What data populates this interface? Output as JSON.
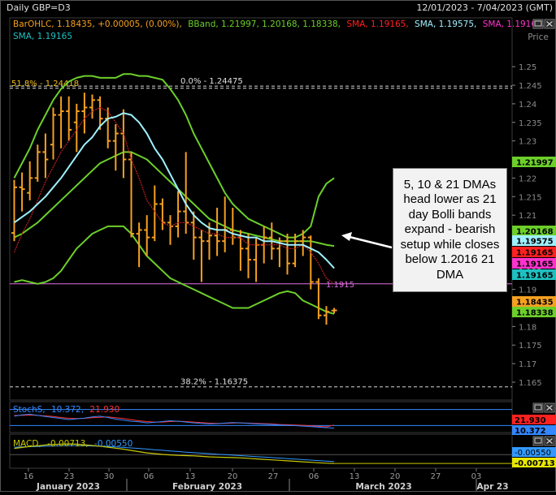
{
  "header": {
    "symbol": "Daily GBP=D3",
    "date_range": "12/01/2023 - 7/04/2023 (GMT)"
  },
  "legend": [
    {
      "text": "BarOHLC, 1.18435, +0.00005, (0.00%),",
      "color": "#f5a020"
    },
    {
      "text": "BBand, 1.21997, 1.20168, 1.18338,",
      "color": "#6ccf2a"
    },
    {
      "text": "SMA, 1.19165,",
      "color": "#ff2020"
    },
    {
      "text": "SMA, 1.19575,",
      "color": "#9ff0ff"
    },
    {
      "text": "SMA, 1.19165,",
      "color": "#ff33cc"
    },
    {
      "text": "SMA, 1.19165",
      "color": "#1ec0c0"
    }
  ],
  "price_axis": {
    "title": "Price",
    "ticks": [
      "1.25",
      "1.245",
      "1.24",
      "1.235",
      "1.23",
      "1.225",
      "1.22",
      "1.215",
      "1.21",
      "1.205",
      "1.2",
      "1.195",
      "1.19",
      "1.185",
      "1.18",
      "1.175",
      "1.17",
      "1.165"
    ],
    "tick_values": [
      1.25,
      1.245,
      1.24,
      1.235,
      1.23,
      1.225,
      1.22,
      1.215,
      1.21,
      1.205,
      1.2,
      1.195,
      1.19,
      1.185,
      1.18,
      1.175,
      1.17,
      1.165
    ]
  },
  "price_tags": [
    {
      "text": "1.21997",
      "value": 1.21997,
      "bg": "#6ccf2a",
      "fg": "#000000"
    },
    {
      "text": "1.20168",
      "value": 1.20168,
      "bg": "#6ccf2a",
      "fg": "#000000"
    },
    {
      "text": "1.19575",
      "value": 1.19575,
      "bg": "#9ff0ff",
      "fg": "#000000"
    },
    {
      "text": "1.19165",
      "value": 1.19165,
      "bg": "#ff2020",
      "fg": "#000000"
    },
    {
      "text": "1.19165",
      "value": 1.19165,
      "bg": "#ff33cc",
      "fg": "#000000"
    },
    {
      "text": "1.19165",
      "value": 1.19165,
      "bg": "#1ec0c0",
      "fg": "#000000"
    },
    {
      "text": "1.18435",
      "value": 1.18435,
      "bg": "#f5a020",
      "fg": "#000000"
    },
    {
      "text": "1.18338",
      "value": 1.18338,
      "bg": "#6ccf2a",
      "fg": "#000000"
    }
  ],
  "fib_levels": [
    {
      "label": "51.8% - 1.24418",
      "value": 1.24418
    },
    {
      "label": "0.0% - 1.24475",
      "value": 1.24475
    },
    {
      "label": "38.2% - 1.16375",
      "value": 1.16375
    }
  ],
  "horizontal_line": {
    "label": "1.1915",
    "value": 1.1915,
    "color": "#e070e0"
  },
  "annotation": "5, 10 & 21 DMAs head lower as 21 day Bolli bands expand - bearish setup while closes below 1.2016 21 DMA",
  "stoch": {
    "label": "StochS,",
    "k_value": "10.372,",
    "d_value": "21.930",
    "tag_d": "21.930",
    "tag_k": "10.372",
    "k_color": "#3388ff",
    "d_color": "#ff3030"
  },
  "macd": {
    "label": "MACD,",
    "v1": "-0.00713,",
    "v2": "-0.00550",
    "tag1": "-0.00550",
    "tag2": "-0.00713",
    "line_color": "#c8c800",
    "signal_color": "#3399ff"
  },
  "x_axis": {
    "day_labels": [
      "16",
      "23",
      "30",
      "06",
      "13",
      "20",
      "27",
      "06",
      "13",
      "20",
      "27",
      "03"
    ],
    "month_labels": [
      "January 2023",
      "February 2023",
      "March 2023",
      "Apr 23"
    ]
  },
  "chart_data": {
    "type": "ohlc",
    "interval": "daily",
    "ylim": [
      1.1615,
      1.2555
    ],
    "bars": [
      {
        "o": 1.2052,
        "h": 1.2195,
        "l": 1.203,
        "c": 1.2175
      },
      {
        "o": 1.2175,
        "h": 1.2215,
        "l": 1.211,
        "c": 1.217
      },
      {
        "o": 1.216,
        "h": 1.2245,
        "l": 1.214,
        "c": 1.22
      },
      {
        "o": 1.22,
        "h": 1.229,
        "l": 1.219,
        "c": 1.227
      },
      {
        "o": 1.227,
        "h": 1.232,
        "l": 1.22,
        "c": 1.225
      },
      {
        "o": 1.229,
        "h": 1.239,
        "l": 1.225,
        "c": 1.237
      },
      {
        "o": 1.237,
        "h": 1.242,
        "l": 1.228,
        "c": 1.238
      },
      {
        "o": 1.238,
        "h": 1.242,
        "l": 1.23,
        "c": 1.233
      },
      {
        "o": 1.235,
        "h": 1.24,
        "l": 1.227,
        "c": 1.238
      },
      {
        "o": 1.238,
        "h": 1.243,
        "l": 1.232,
        "c": 1.239
      },
      {
        "o": 1.239,
        "h": 1.2425,
        "l": 1.236,
        "c": 1.241
      },
      {
        "o": 1.241,
        "h": 1.242,
        "l": 1.233,
        "c": 1.236
      },
      {
        "o": 1.236,
        "h": 1.239,
        "l": 1.228,
        "c": 1.23
      },
      {
        "o": 1.23,
        "h": 1.2345,
        "l": 1.222,
        "c": 1.232
      },
      {
        "o": 1.232,
        "h": 1.2385,
        "l": 1.22,
        "c": 1.225
      },
      {
        "o": 1.225,
        "h": 1.227,
        "l": 1.204,
        "c": 1.205
      },
      {
        "o": 1.205,
        "h": 1.208,
        "l": 1.196,
        "c": 1.206
      },
      {
        "o": 1.206,
        "h": 1.21,
        "l": 1.199,
        "c": 1.204
      },
      {
        "o": 1.204,
        "h": 1.218,
        "l": 1.203,
        "c": 1.213
      },
      {
        "o": 1.213,
        "h": 1.2145,
        "l": 1.206,
        "c": 1.208
      },
      {
        "o": 1.208,
        "h": 1.21,
        "l": 1.202,
        "c": 1.207
      },
      {
        "o": 1.207,
        "h": 1.2165,
        "l": 1.204,
        "c": 1.211
      },
      {
        "o": 1.211,
        "h": 1.227,
        "l": 1.205,
        "c": 1.208
      },
      {
        "o": 1.208,
        "h": 1.211,
        "l": 1.198,
        "c": 1.204
      },
      {
        "o": 1.204,
        "h": 1.206,
        "l": 1.192,
        "c": 1.203
      },
      {
        "o": 1.203,
        "h": 1.208,
        "l": 1.198,
        "c": 1.2045
      },
      {
        "o": 1.2045,
        "h": 1.212,
        "l": 1.199,
        "c": 1.203
      },
      {
        "o": 1.203,
        "h": 1.215,
        "l": 1.2,
        "c": 1.206
      },
      {
        "o": 1.206,
        "h": 1.212,
        "l": 1.202,
        "c": 1.204
      },
      {
        "o": 1.204,
        "h": 1.206,
        "l": 1.195,
        "c": 1.201
      },
      {
        "o": 1.201,
        "h": 1.205,
        "l": 1.193,
        "c": 1.198
      },
      {
        "o": 1.198,
        "h": 1.204,
        "l": 1.192,
        "c": 1.202
      },
      {
        "o": 1.202,
        "h": 1.207,
        "l": 1.197,
        "c": 1.204
      },
      {
        "o": 1.204,
        "h": 1.208,
        "l": 1.198,
        "c": 1.201
      },
      {
        "o": 1.201,
        "h": 1.204,
        "l": 1.196,
        "c": 1.203
      },
      {
        "o": 1.203,
        "h": 1.205,
        "l": 1.194,
        "c": 1.197
      },
      {
        "o": 1.197,
        "h": 1.205,
        "l": 1.196,
        "c": 1.203
      },
      {
        "o": 1.203,
        "h": 1.206,
        "l": 1.199,
        "c": 1.204
      },
      {
        "o": 1.204,
        "h": 1.2045,
        "l": 1.19,
        "c": 1.192
      },
      {
        "o": 1.192,
        "h": 1.193,
        "l": 1.182,
        "c": 1.183
      },
      {
        "o": 1.183,
        "h": 1.1855,
        "l": 1.1805,
        "c": 1.184
      },
      {
        "o": 1.1843,
        "h": 1.185,
        "l": 1.1835,
        "c": 1.18435
      }
    ],
    "sma_fast": [
      1.2,
      1.205,
      1.209,
      1.214,
      1.219,
      1.223,
      1.227,
      1.23,
      1.233,
      1.236,
      1.238,
      1.239,
      1.238,
      1.235,
      1.232,
      1.225,
      1.22,
      1.214,
      1.211,
      1.208,
      1.207,
      1.208,
      1.208,
      1.207,
      1.206,
      1.205,
      1.205,
      1.204,
      1.204,
      1.204,
      1.202,
      1.202,
      1.202,
      1.202,
      1.202,
      1.201,
      1.201,
      1.202,
      1.2,
      1.197,
      1.193,
      1.1915
    ],
    "sma_mid": [
      1.208,
      1.2095,
      1.211,
      1.213,
      1.215,
      1.2175,
      1.22,
      1.223,
      1.226,
      1.229,
      1.231,
      1.234,
      1.236,
      1.2365,
      1.2375,
      1.237,
      1.235,
      1.232,
      1.228,
      1.225,
      1.221,
      1.217,
      1.213,
      1.21,
      1.208,
      1.2065,
      1.206,
      1.206,
      1.205,
      1.2045,
      1.204,
      1.204,
      1.203,
      1.203,
      1.2025,
      1.202,
      1.202,
      1.202,
      1.201,
      1.2,
      1.198,
      1.1957
    ],
    "bb_upper": [
      1.22,
      1.224,
      1.228,
      1.233,
      1.237,
      1.241,
      1.244,
      1.246,
      1.247,
      1.2475,
      1.2475,
      1.247,
      1.247,
      1.247,
      1.248,
      1.248,
      1.2475,
      1.2475,
      1.247,
      1.2465,
      1.244,
      1.241,
      1.237,
      1.232,
      1.228,
      1.224,
      1.22,
      1.216,
      1.213,
      1.211,
      1.209,
      1.208,
      1.207,
      1.206,
      1.205,
      1.204,
      1.204,
      1.205,
      1.207,
      1.215,
      1.2185,
      1.22
    ],
    "bb_middle": [
      1.204,
      1.205,
      1.2065,
      1.208,
      1.21,
      1.212,
      1.214,
      1.216,
      1.218,
      1.22,
      1.222,
      1.224,
      1.225,
      1.226,
      1.227,
      1.227,
      1.226,
      1.225,
      1.223,
      1.221,
      1.219,
      1.217,
      1.215,
      1.213,
      1.211,
      1.209,
      1.208,
      1.207,
      1.206,
      1.2055,
      1.205,
      1.2045,
      1.204,
      1.2035,
      1.203,
      1.203,
      1.203,
      1.203,
      1.203,
      1.2025,
      1.202,
      1.2017
    ],
    "bb_lower": [
      1.192,
      1.1925,
      1.192,
      1.1915,
      1.192,
      1.193,
      1.195,
      1.198,
      1.201,
      1.203,
      1.205,
      1.206,
      1.207,
      1.207,
      1.207,
      1.205,
      1.202,
      1.199,
      1.197,
      1.195,
      1.193,
      1.192,
      1.191,
      1.19,
      1.189,
      1.188,
      1.187,
      1.186,
      1.185,
      1.185,
      1.185,
      1.186,
      1.187,
      1.188,
      1.189,
      1.1895,
      1.189,
      1.187,
      1.186,
      1.185,
      1.184,
      1.1834
    ],
    "bb_upper_x_offset": 0,
    "stoch_k": [
      55,
      60,
      62,
      58,
      54,
      50,
      46,
      42,
      45,
      48,
      52,
      55,
      50,
      44,
      40,
      36,
      34,
      30,
      32,
      35,
      38,
      36,
      33,
      30,
      28,
      26,
      27,
      29,
      31,
      30,
      28,
      26,
      25,
      24,
      22,
      21,
      20,
      18,
      16,
      14,
      12,
      10.372
    ],
    "stoch_d": [
      58,
      58,
      59,
      58,
      56,
      54,
      50,
      47,
      46,
      47,
      49,
      51,
      52,
      49,
      46,
      42,
      38,
      35,
      33,
      33,
      35,
      36,
      35,
      33,
      31,
      29,
      28,
      28,
      29,
      30,
      29,
      28,
      27,
      26,
      24,
      23,
      22,
      21,
      19,
      17,
      15,
      21.93
    ],
    "stoch_ylim": [
      0,
      100
    ],
    "macd_line": [
      0.005,
      0.0058,
      0.0066,
      0.0072,
      0.0078,
      0.0082,
      0.0085,
      0.0086,
      0.0084,
      0.008,
      0.0074,
      0.0068,
      0.006,
      0.0052,
      0.0044,
      0.0034,
      0.0024,
      0.0014,
      0.0008,
      0.0002,
      -0.0002,
      -0.0006,
      -0.0008,
      -0.001,
      -0.0014,
      -0.0018,
      -0.002,
      -0.0022,
      -0.0024,
      -0.0026,
      -0.003,
      -0.0034,
      -0.0038,
      -0.0042,
      -0.0046,
      -0.005,
      -0.0054,
      -0.0058,
      -0.0062,
      -0.0066,
      -0.0069,
      -0.00713
    ],
    "macd_signal": [
      0.006,
      0.0062,
      0.0064,
      0.0066,
      0.0068,
      0.007,
      0.0072,
      0.0073,
      0.0073,
      0.0072,
      0.007,
      0.0068,
      0.0065,
      0.0062,
      0.0058,
      0.0054,
      0.005,
      0.0045,
      0.004,
      0.0035,
      0.003,
      0.0025,
      0.002,
      0.0016,
      0.0012,
      0.0008,
      0.0004,
      0.0,
      -0.0004,
      -0.0008,
      -0.0012,
      -0.0016,
      -0.002,
      -0.0024,
      -0.0028,
      -0.0032,
      -0.0036,
      -0.004,
      -0.0044,
      -0.0048,
      -0.0052,
      -0.0055
    ],
    "macd_ylim": [
      -0.009,
      0.01
    ]
  }
}
